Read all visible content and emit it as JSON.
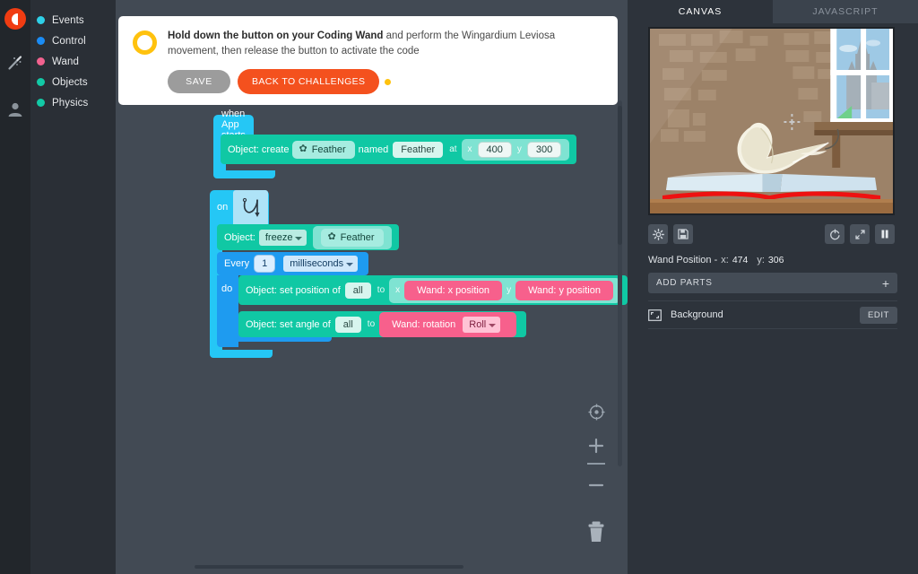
{
  "rail": {
    "logo": "app-logo",
    "icons": [
      {
        "name": "wand-icon"
      },
      {
        "name": "user-account-icon"
      }
    ]
  },
  "sidebar": {
    "items": [
      {
        "label": "Events",
        "color": "#2ed0e8"
      },
      {
        "label": "Control",
        "color": "#1a8cf5"
      },
      {
        "label": "Wand",
        "color": "#f2628f"
      },
      {
        "label": "Objects",
        "color": "#12c9a6"
      },
      {
        "label": "Physics",
        "color": "#12c9a6"
      }
    ]
  },
  "banner": {
    "text_bold": "Hold down the button on your Coding Wand",
    "text_rest": " and perform the Wingardium Leviosa movement, then release the button to activate the code",
    "save_label": "SAVE",
    "challenges_label": "BACK TO CHALLENGES",
    "ring_color": "#ffc20e",
    "challenges_color": "#f4511e"
  },
  "blocks": {
    "stack1": {
      "hat_label": "when App starts",
      "row": {
        "prefix": "Object: create",
        "object_name": "Feather",
        "named_label": "named",
        "named_value": "Feather",
        "at_label": "at",
        "x_label": "x",
        "x_value": "400",
        "y_label": "y",
        "y_value": "300"
      }
    },
    "stack2": {
      "on_label": "on",
      "gesture": "wingardium-leviosa-gesture",
      "freeze_row": {
        "prefix": "Object:",
        "action": "freeze",
        "object_name": "Feather"
      },
      "every_row": {
        "prefix": "Every",
        "amount": "1",
        "unit": "milliseconds"
      },
      "do_label": "do",
      "set_position_row": {
        "prefix": "Object: set position of",
        "target": "all",
        "to_label": "to",
        "x_label": "x",
        "x_value": "Wand: x position",
        "y_label": "y",
        "y_value": "Wand: y position"
      },
      "set_angle_row": {
        "prefix": "Object: set angle of",
        "target": "all",
        "to_label": "to",
        "value": "Wand: rotation",
        "axis": "Roll"
      }
    }
  },
  "workspace_controls": [
    {
      "name": "center-blocks-icon"
    },
    {
      "name": "zoom-in-icon"
    },
    {
      "name": "zoom-out-icon"
    },
    {
      "name": "delete-trash-icon"
    }
  ],
  "right_panel": {
    "tabs": [
      {
        "label": "CANVAS",
        "active": true
      },
      {
        "label": "JAVASCRIPT",
        "active": false
      }
    ],
    "canvas_scene": "hogwarts-library-feather-over-book",
    "left_tools": [
      {
        "name": "settings-gear-icon"
      },
      {
        "name": "save-disk-icon"
      }
    ],
    "right_tools": [
      {
        "name": "restart-icon"
      },
      {
        "name": "fullscreen-icon"
      },
      {
        "name": "pause-icon"
      }
    ],
    "wand_position": {
      "label": "Wand Position -",
      "x_label": "x:",
      "x_value": "474",
      "y_label": "y:",
      "y_value": "306"
    },
    "add_parts": {
      "label": "ADD PARTS",
      "plus": "+"
    },
    "layers": [
      {
        "name": "Background",
        "edit_label": "EDIT",
        "icon": "background-layer-icon"
      }
    ]
  }
}
